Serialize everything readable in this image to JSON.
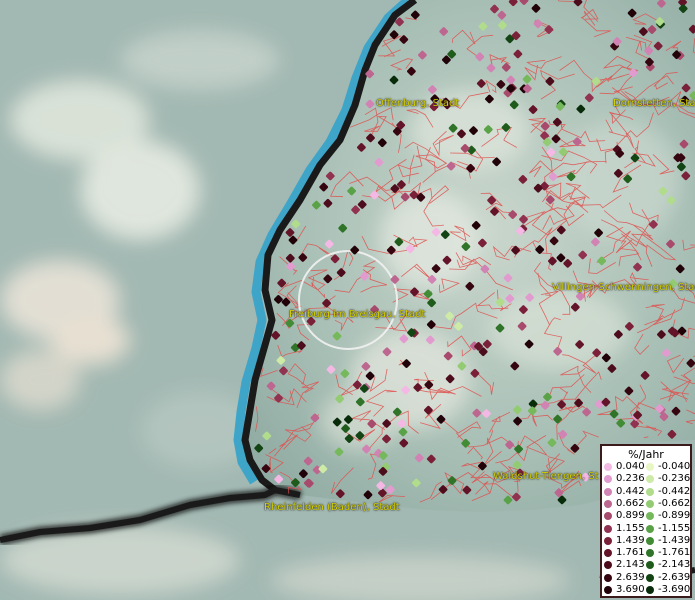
{
  "map": {
    "labels": [
      {
        "id": "offenburg",
        "text": "Offenburg, Stadt"
      },
      {
        "id": "dornstetten",
        "text": "Dornstetten, Stadt"
      },
      {
        "id": "villingen",
        "text": "Villingen-Schwenningen, Stadt"
      },
      {
        "id": "freiburg",
        "text": "Freiburg im Breisgau, Stadt"
      },
      {
        "id": "waldshut",
        "text": "Waldshut-Tiengen, St"
      },
      {
        "id": "rheinfelden",
        "text": "Rheinfelden (Baden), Stadt"
      }
    ]
  },
  "legend": {
    "title": "%/Jahr",
    "positive": [
      "0.040",
      "0.236",
      "0.442",
      "0.662",
      "0.899",
      "1.155",
      "1.439",
      "1.761",
      "2.143",
      "2.639",
      "3.690"
    ],
    "negative": [
      "-0.040",
      "-0.236",
      "-0.442",
      "-0.662",
      "-0.899",
      "-1.155",
      "-1.439",
      "-1.761",
      "-2.143",
      "-2.639",
      "-3.690"
    ],
    "positive_colors": [
      "#f4b8e4",
      "#e29bcf",
      "#d183b4",
      "#bd6690",
      "#a84a6c",
      "#913350",
      "#7a2038",
      "#641428",
      "#4c0c1c",
      "#360610",
      "#200208"
    ],
    "negative_colors": [
      "#e8f7c4",
      "#cdeaa6",
      "#b0dc8c",
      "#93cb72",
      "#76b85c",
      "#5aa247",
      "#438c36",
      "#2f7428",
      "#1f5c1c",
      "#124414",
      "#082c0a"
    ]
  }
}
